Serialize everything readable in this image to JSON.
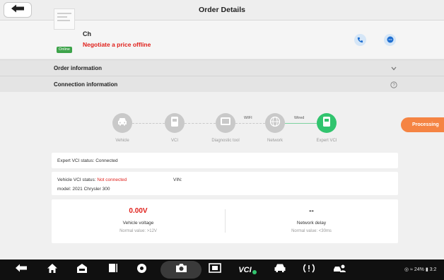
{
  "header": {
    "title": "Order Details",
    "back_icon": "back-arrow-icon"
  },
  "shop": {
    "name": "Ch",
    "online_badge": "Online",
    "note": "Negotiate a price offline",
    "call_icon": "phone-icon",
    "chat_icon": "chat-icon"
  },
  "sections": {
    "order_information": "Order information",
    "connection_information": "Connection information"
  },
  "connection": {
    "nodes": [
      {
        "label": "Vehicle",
        "icon": "car-icon"
      },
      {
        "label": "VCI",
        "icon": "vci-icon"
      },
      {
        "label": "Diagnostic tool",
        "icon": "tablet-icon"
      },
      {
        "label": "Network",
        "icon": "globe-icon"
      },
      {
        "label": "Expert VCI",
        "icon": "expert-vci-icon"
      }
    ],
    "wifi_label": "WIFI",
    "wired_label": "Wired",
    "vci_chip_text": "VCI"
  },
  "status_button": "Processing",
  "expert_status": {
    "label": "Expert VCI status:",
    "value": "Connected"
  },
  "vehicle_status": {
    "label": "Vehicle VCI status:",
    "value": "Not connected",
    "vin_label": "VIN:",
    "model_label": "model:",
    "model_value": "2021 Chrysler 300"
  },
  "metrics": {
    "voltage": {
      "value": "0.00V",
      "label": "Vehicle voltage",
      "normal": "Normal value: >12V"
    },
    "delay": {
      "value": "--",
      "label": "Network delay",
      "normal": "Normal value: <30ms"
    }
  },
  "system_bar": {
    "status": "24%",
    "time": "3:2",
    "vci_label": "VCI",
    "colors": {
      "accent_orange": "#f58443",
      "active_green": "#31c46e",
      "alert_red": "#e0201b"
    }
  }
}
